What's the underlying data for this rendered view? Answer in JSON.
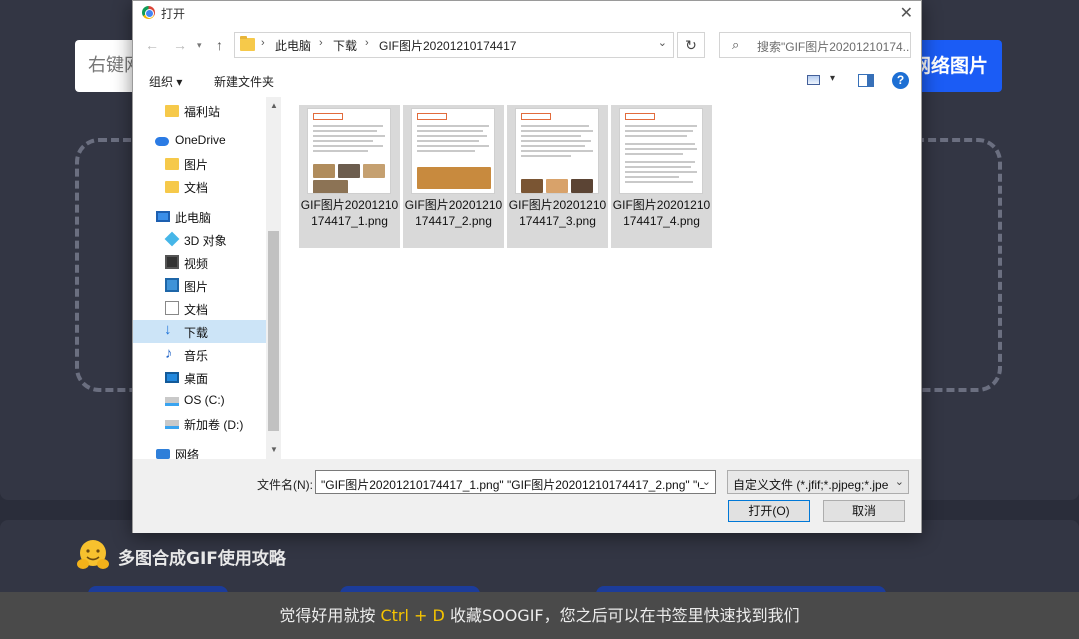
{
  "page": {
    "url_input_placeholder": "右键网",
    "url_button_label": "网络图片",
    "guide_title": "多图合成GIF使用攻略",
    "bottom_tip": {
      "before": "觉得好用就按",
      "shortcut": "Ctrl + D",
      "after": "收藏SOOGIF，您之后可以在书签里快速找到我们"
    }
  },
  "dialog": {
    "title": "打开",
    "breadcrumb": [
      "此电脑",
      "下载",
      "GIF图片20201210174417"
    ],
    "search_placeholder": "搜索\"GIF图片20201210174...",
    "toolbar": {
      "organize": "组织 ▾",
      "new_folder": "新建文件夹"
    },
    "sidebar": [
      {
        "label": "福利站",
        "icon": "folder-icon",
        "selected": false
      },
      {
        "label": "OneDrive",
        "icon": "onedrive-icon",
        "selected": false
      },
      {
        "label": "图片",
        "icon": "folder-icon",
        "selected": false
      },
      {
        "label": "文档",
        "icon": "folder-icon",
        "selected": false
      },
      {
        "label": "此电脑",
        "icon": "computer-icon",
        "selected": false
      },
      {
        "label": "3D 对象",
        "icon": "cube-icon",
        "selected": false
      },
      {
        "label": "视频",
        "icon": "video-icon",
        "selected": false
      },
      {
        "label": "图片",
        "icon": "pictures-icon",
        "selected": false
      },
      {
        "label": "文档",
        "icon": "document-icon",
        "selected": false
      },
      {
        "label": "下载",
        "icon": "download-icon",
        "selected": true
      },
      {
        "label": "音乐",
        "icon": "music-icon",
        "selected": false
      },
      {
        "label": "桌面",
        "icon": "desktop-icon",
        "selected": false
      },
      {
        "label": "OS (C:)",
        "icon": "drive-icon",
        "selected": false
      },
      {
        "label": "新加卷 (D:)",
        "icon": "drive-icon",
        "selected": false
      },
      {
        "label": "网络",
        "icon": "network-icon",
        "selected": false
      }
    ],
    "files": [
      {
        "name": "GIF图片20201210174417_1.png"
      },
      {
        "name": "GIF图片20201210174417_2.png"
      },
      {
        "name": "GIF图片20201210174417_3.png"
      },
      {
        "name": "GIF图片20201210174417_4.png"
      }
    ],
    "footer": {
      "filename_label": "文件名(N):",
      "filename_value": "\"GIF图片20201210174417_1.png\" \"GIF图片20201210174417_2.png\" \"G",
      "filter_value": "自定义文件 (*.jfif;*.pjpeg;*.jpe",
      "open_label": "打开(O)",
      "cancel_label": "取消"
    }
  }
}
